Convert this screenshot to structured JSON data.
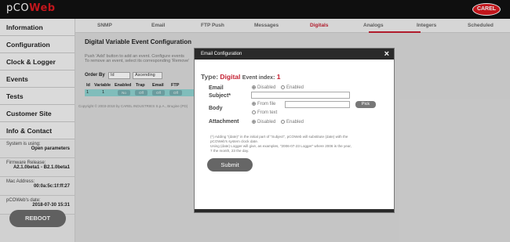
{
  "header": {
    "logo_left": "pCO",
    "logo_right": "Web",
    "brand": "CAREL"
  },
  "sidebar": {
    "items": [
      {
        "label": "Information"
      },
      {
        "label": "Configuration"
      },
      {
        "label": "Clock & Logger"
      },
      {
        "label": "Events"
      },
      {
        "label": "Tests"
      },
      {
        "label": "Customer Site"
      },
      {
        "label": "Info & Contact"
      }
    ],
    "info": [
      {
        "label": "System is using:",
        "value": "Open parameters"
      },
      {
        "label": "Firmware Release:",
        "value": "A2.1.0beta1 - B2.1.0beta1"
      },
      {
        "label": "Mac Address:",
        "value": "00:0a:5c:1f:ff:27"
      },
      {
        "label": "pCOWeb's date:",
        "value": "2018-07-30 15:31"
      }
    ],
    "reboot_label": "REBOOT"
  },
  "tabs": [
    "SNMP",
    "Email",
    "FTP Push",
    "Messages",
    "Digitals",
    "Analogs",
    "Integers",
    "Scheduled"
  ],
  "active_tab": "Digitals",
  "content": {
    "heading": "Digital Variable Event Configuration",
    "hint1": "Push 'Add' button to add an event. Configure events",
    "hint2": "To remove an event, select its corresponding 'Remove'",
    "order_by_label": "Order By",
    "order_field": "Id",
    "order_dir": "Ascending",
    "columns": [
      "Id",
      "Variable",
      "Enabled",
      "Trap",
      "Email",
      "FTP"
    ],
    "row": {
      "id": "1",
      "variable": "1",
      "enabled": "No",
      "trap": "Off",
      "email": "Off",
      "ftp": "Off"
    },
    "copyright": "Copyright © 2003-2018 by CAREL INDUSTRIES S.p.A., Brugine (PD)"
  },
  "modal": {
    "title": "Email Configuration",
    "close_icon": "×",
    "type_label": "Type:",
    "type_value": "Digital",
    "index_label": "Event index:",
    "index_value": "1",
    "email_label": "Email",
    "subject_label": "Subject*",
    "body_label": "Body",
    "attachment_label": "Attachment",
    "disabled": "Disabled",
    "enabled": "Enabled",
    "from_file": "From file",
    "from_text": "From text",
    "pick_label": "Pick",
    "note1": "(*) Adding \"(date)\" in the initial part of \"Subject\", pCOWeb will substitute (date) with the",
    "note2": "pCOWeb's system clock date.",
    "note3": "Using (date) Logger will give, as examples, \"2006-07-23 Logger\" where 2006 is the year,",
    "note4": "7 the month, 23 the day.",
    "submit_label": "Submit"
  },
  "colors": {
    "accent": "#c41f31",
    "header_bg": "#111111",
    "row_bg": "#8fd3d1"
  }
}
